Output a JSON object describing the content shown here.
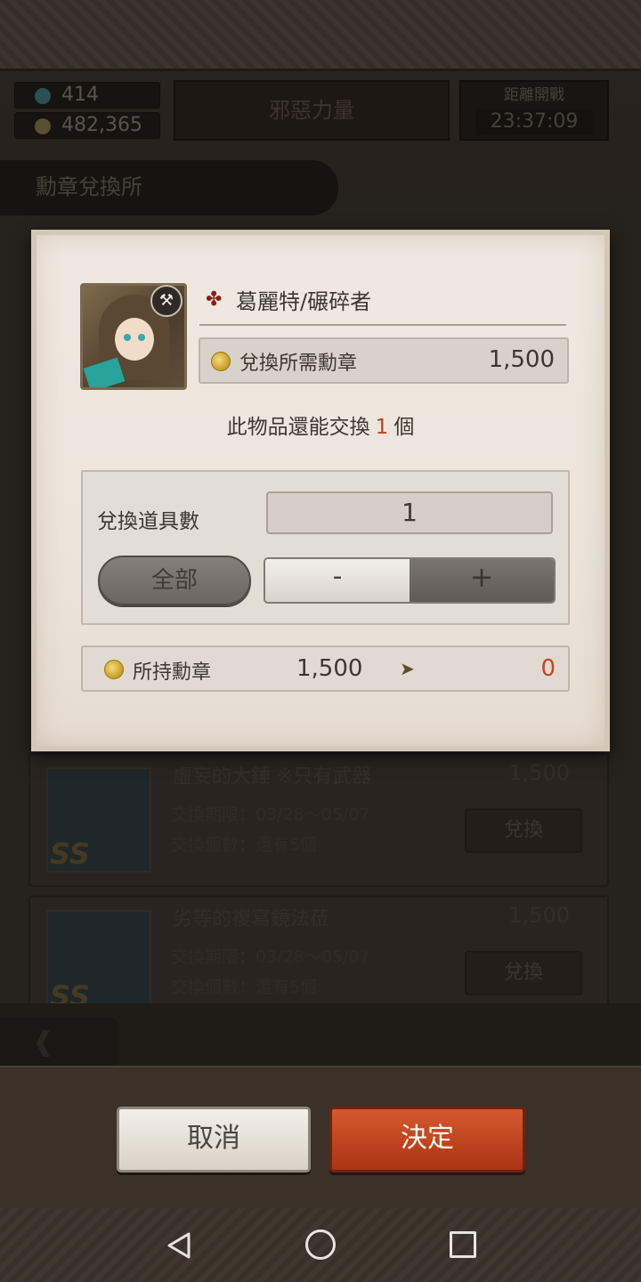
{
  "header": {
    "gems": "414",
    "coins": "482,365",
    "event_name": "邪惡力量",
    "timer_label": "距離開戰",
    "timer_value": "23:37:09"
  },
  "section_title": "勳章兌換所",
  "list": {
    "items": [
      {
        "name": "虛妄的大錘 ※只有武器",
        "cost": "1,500",
        "period": "交換期限：03/28～05/07",
        "count": "交換個數：還有5個",
        "button": "兌換",
        "rank": "SS"
      },
      {
        "name": "劣等的複寫鏡法莅",
        "cost": "1,500",
        "period": "交換期限：03/28～05/07",
        "count": "交換個數：還有5個",
        "button": "兌換",
        "rank": "SS"
      }
    ]
  },
  "dialog": {
    "item_name": "葛麗特/碾碎者",
    "cost_label": "兌換所需勳章",
    "cost_value": "1,500",
    "remain_prefix": "此物品還能交換",
    "remain_count": "1",
    "remain_suffix": "個",
    "qty_label": "兌換道具數",
    "qty_value": "1",
    "all_button": "全部",
    "minus_label": "-",
    "plus_label": "+",
    "owned_label": "所持勳章",
    "owned_value": "1,500",
    "owned_result": "0"
  },
  "actions": {
    "cancel": "取消",
    "confirm": "決定"
  },
  "colors": {
    "accent_red": "#c23e1a",
    "confirm_button": "#c24520"
  }
}
